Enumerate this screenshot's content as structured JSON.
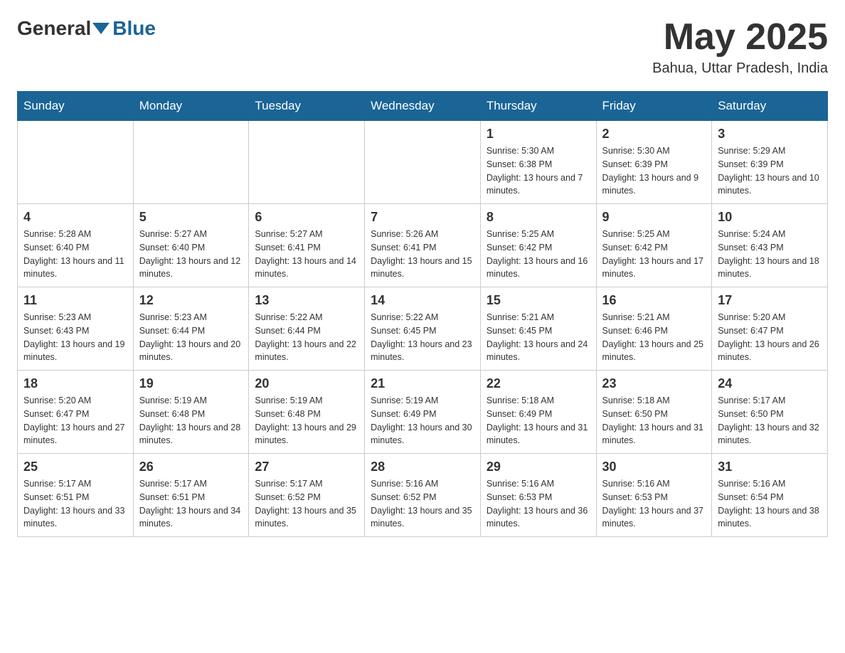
{
  "header": {
    "logo_general": "General",
    "logo_blue": "Blue",
    "month_title": "May 2025",
    "location": "Bahua, Uttar Pradesh, India"
  },
  "weekdays": [
    "Sunday",
    "Monday",
    "Tuesday",
    "Wednesday",
    "Thursday",
    "Friday",
    "Saturday"
  ],
  "weeks": [
    [
      {
        "day": "",
        "sunrise": "",
        "sunset": "",
        "daylight": ""
      },
      {
        "day": "",
        "sunrise": "",
        "sunset": "",
        "daylight": ""
      },
      {
        "day": "",
        "sunrise": "",
        "sunset": "",
        "daylight": ""
      },
      {
        "day": "",
        "sunrise": "",
        "sunset": "",
        "daylight": ""
      },
      {
        "day": "1",
        "sunrise": "Sunrise: 5:30 AM",
        "sunset": "Sunset: 6:38 PM",
        "daylight": "Daylight: 13 hours and 7 minutes."
      },
      {
        "day": "2",
        "sunrise": "Sunrise: 5:30 AM",
        "sunset": "Sunset: 6:39 PM",
        "daylight": "Daylight: 13 hours and 9 minutes."
      },
      {
        "day": "3",
        "sunrise": "Sunrise: 5:29 AM",
        "sunset": "Sunset: 6:39 PM",
        "daylight": "Daylight: 13 hours and 10 minutes."
      }
    ],
    [
      {
        "day": "4",
        "sunrise": "Sunrise: 5:28 AM",
        "sunset": "Sunset: 6:40 PM",
        "daylight": "Daylight: 13 hours and 11 minutes."
      },
      {
        "day": "5",
        "sunrise": "Sunrise: 5:27 AM",
        "sunset": "Sunset: 6:40 PM",
        "daylight": "Daylight: 13 hours and 12 minutes."
      },
      {
        "day": "6",
        "sunrise": "Sunrise: 5:27 AM",
        "sunset": "Sunset: 6:41 PM",
        "daylight": "Daylight: 13 hours and 14 minutes."
      },
      {
        "day": "7",
        "sunrise": "Sunrise: 5:26 AM",
        "sunset": "Sunset: 6:41 PM",
        "daylight": "Daylight: 13 hours and 15 minutes."
      },
      {
        "day": "8",
        "sunrise": "Sunrise: 5:25 AM",
        "sunset": "Sunset: 6:42 PM",
        "daylight": "Daylight: 13 hours and 16 minutes."
      },
      {
        "day": "9",
        "sunrise": "Sunrise: 5:25 AM",
        "sunset": "Sunset: 6:42 PM",
        "daylight": "Daylight: 13 hours and 17 minutes."
      },
      {
        "day": "10",
        "sunrise": "Sunrise: 5:24 AM",
        "sunset": "Sunset: 6:43 PM",
        "daylight": "Daylight: 13 hours and 18 minutes."
      }
    ],
    [
      {
        "day": "11",
        "sunrise": "Sunrise: 5:23 AM",
        "sunset": "Sunset: 6:43 PM",
        "daylight": "Daylight: 13 hours and 19 minutes."
      },
      {
        "day": "12",
        "sunrise": "Sunrise: 5:23 AM",
        "sunset": "Sunset: 6:44 PM",
        "daylight": "Daylight: 13 hours and 20 minutes."
      },
      {
        "day": "13",
        "sunrise": "Sunrise: 5:22 AM",
        "sunset": "Sunset: 6:44 PM",
        "daylight": "Daylight: 13 hours and 22 minutes."
      },
      {
        "day": "14",
        "sunrise": "Sunrise: 5:22 AM",
        "sunset": "Sunset: 6:45 PM",
        "daylight": "Daylight: 13 hours and 23 minutes."
      },
      {
        "day": "15",
        "sunrise": "Sunrise: 5:21 AM",
        "sunset": "Sunset: 6:45 PM",
        "daylight": "Daylight: 13 hours and 24 minutes."
      },
      {
        "day": "16",
        "sunrise": "Sunrise: 5:21 AM",
        "sunset": "Sunset: 6:46 PM",
        "daylight": "Daylight: 13 hours and 25 minutes."
      },
      {
        "day": "17",
        "sunrise": "Sunrise: 5:20 AM",
        "sunset": "Sunset: 6:47 PM",
        "daylight": "Daylight: 13 hours and 26 minutes."
      }
    ],
    [
      {
        "day": "18",
        "sunrise": "Sunrise: 5:20 AM",
        "sunset": "Sunset: 6:47 PM",
        "daylight": "Daylight: 13 hours and 27 minutes."
      },
      {
        "day": "19",
        "sunrise": "Sunrise: 5:19 AM",
        "sunset": "Sunset: 6:48 PM",
        "daylight": "Daylight: 13 hours and 28 minutes."
      },
      {
        "day": "20",
        "sunrise": "Sunrise: 5:19 AM",
        "sunset": "Sunset: 6:48 PM",
        "daylight": "Daylight: 13 hours and 29 minutes."
      },
      {
        "day": "21",
        "sunrise": "Sunrise: 5:19 AM",
        "sunset": "Sunset: 6:49 PM",
        "daylight": "Daylight: 13 hours and 30 minutes."
      },
      {
        "day": "22",
        "sunrise": "Sunrise: 5:18 AM",
        "sunset": "Sunset: 6:49 PM",
        "daylight": "Daylight: 13 hours and 31 minutes."
      },
      {
        "day": "23",
        "sunrise": "Sunrise: 5:18 AM",
        "sunset": "Sunset: 6:50 PM",
        "daylight": "Daylight: 13 hours and 31 minutes."
      },
      {
        "day": "24",
        "sunrise": "Sunrise: 5:17 AM",
        "sunset": "Sunset: 6:50 PM",
        "daylight": "Daylight: 13 hours and 32 minutes."
      }
    ],
    [
      {
        "day": "25",
        "sunrise": "Sunrise: 5:17 AM",
        "sunset": "Sunset: 6:51 PM",
        "daylight": "Daylight: 13 hours and 33 minutes."
      },
      {
        "day": "26",
        "sunrise": "Sunrise: 5:17 AM",
        "sunset": "Sunset: 6:51 PM",
        "daylight": "Daylight: 13 hours and 34 minutes."
      },
      {
        "day": "27",
        "sunrise": "Sunrise: 5:17 AM",
        "sunset": "Sunset: 6:52 PM",
        "daylight": "Daylight: 13 hours and 35 minutes."
      },
      {
        "day": "28",
        "sunrise": "Sunrise: 5:16 AM",
        "sunset": "Sunset: 6:52 PM",
        "daylight": "Daylight: 13 hours and 35 minutes."
      },
      {
        "day": "29",
        "sunrise": "Sunrise: 5:16 AM",
        "sunset": "Sunset: 6:53 PM",
        "daylight": "Daylight: 13 hours and 36 minutes."
      },
      {
        "day": "30",
        "sunrise": "Sunrise: 5:16 AM",
        "sunset": "Sunset: 6:53 PM",
        "daylight": "Daylight: 13 hours and 37 minutes."
      },
      {
        "day": "31",
        "sunrise": "Sunrise: 5:16 AM",
        "sunset": "Sunset: 6:54 PM",
        "daylight": "Daylight: 13 hours and 38 minutes."
      }
    ]
  ]
}
